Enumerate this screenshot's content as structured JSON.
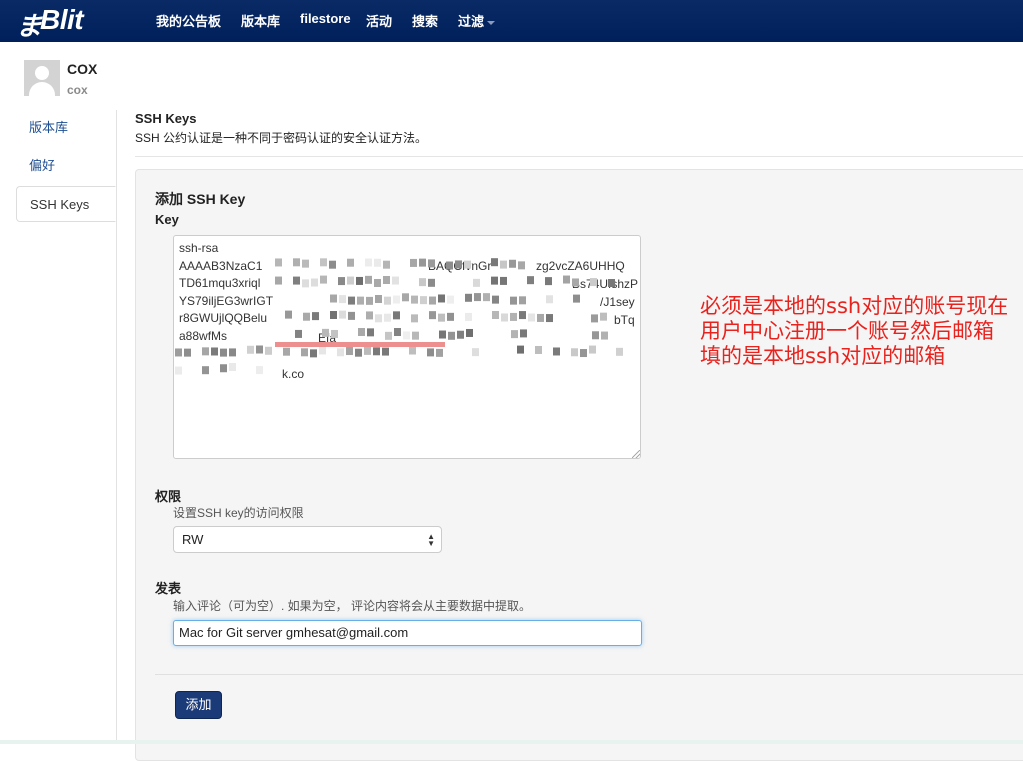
{
  "navbar": {
    "brand_glyph": "ま",
    "brand_text": "Blit",
    "items": [
      "我的公告板",
      "版本库",
      "filestore",
      "活动",
      "搜索",
      "过滤"
    ]
  },
  "user": {
    "display_name": "COX",
    "username": "cox"
  },
  "sidebar": {
    "items": [
      {
        "label": "版本库",
        "active": false
      },
      {
        "label": "偏好",
        "active": false
      },
      {
        "label": "SSH Keys",
        "active": true
      }
    ]
  },
  "section": {
    "title": "SSH Keys",
    "description": "SSH 公约认证是一种不同于密码认证的安全认证方法。"
  },
  "form": {
    "heading": "添加 SSH Key",
    "key_label": "Key",
    "key_lines": [
      "ssh-rsa",
      "AAAAB3NzaC1",
      "TD61mqu3xriql",
      "YS79iljEG3wrIGT",
      "r8GWUjlQQBelu",
      "a88wfMs"
    ],
    "key_fragments": {
      "l1_right": "BAQCfvnGr",
      "l1_far": "zg2vcZA6UHHQ",
      "l2_right": "Bs74UfshzP",
      "l3_right": "/J1sey",
      "l4_right": "bTq",
      "l5_mid": "Efa",
      "l7": "k.co"
    },
    "permission_label": "权限",
    "permission_hint": "设置SSH key的访问权限",
    "permission_value": "RW",
    "comment_label": "发表",
    "comment_hint": "输入评论（可为空）. 如果为空， 评论内容将会从主要数据中提取。",
    "comment_value": "Mac for Git server gmhesat@gmail.com",
    "submit_label": "添加"
  },
  "annotation": {
    "text": "必须是本地的ssh对应的账号现在用户中心注册一个账号然后邮箱填的是本地ssh对应的邮箱"
  },
  "colors": {
    "navbar": "#00205b",
    "link": "#1f4f91",
    "button": "#1b3a78",
    "annotation": "#e8231e"
  }
}
